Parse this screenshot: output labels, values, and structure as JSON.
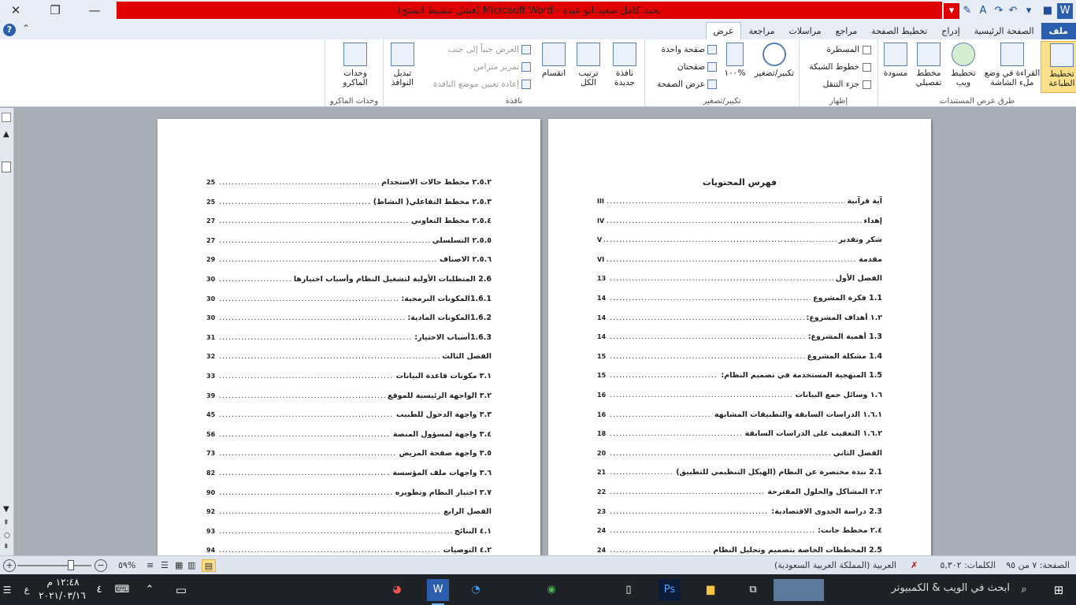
{
  "window": {
    "title": "بحث كامل سعيد ابو عبدة  -  Microsoft Word  (فشل تنشيط المنتج)",
    "minimize": "—",
    "maximize": "❐",
    "close": "✕"
  },
  "tabs": [
    "ملف",
    "الصفحة الرئيسية",
    "إدراج",
    "تخطيط الصفحة",
    "مراجع",
    "مراسلات",
    "مراجعة",
    "عرض"
  ],
  "active_tab": "عرض",
  "ribbon": {
    "groups": {
      "doc_views": {
        "label": "طرق عرض المستندات",
        "print_layout": "تخطيط الطباعة",
        "full_screen": "القراءة في وضع ملء الشاشة",
        "web_layout": "تخطيط ويب",
        "outline": "مخطط تفصيلي",
        "draft": "مسودة"
      },
      "show": {
        "label": "إظهار",
        "ruler": "المسطرة",
        "gridlines": "خطوط الشبكة",
        "nav_pane": "جزء التنقل"
      },
      "zoom": {
        "label": "تكبير/تصغير",
        "zoom": "تكبير/تصغير",
        "hundred": "١٠٠%",
        "one_page": "صفحة واحدة",
        "two_pages": "صفحتان",
        "page_width": "عرض الصفحة"
      },
      "window": {
        "label": "نافذة",
        "new_window": "نافذة جديدة",
        "arrange_all": "ترتيب الكل",
        "split": "انقسام",
        "side_by_side": "العرض جنباً إلى جنب",
        "sync_scroll": "تمرير متزامن",
        "reset_pos": "إعادة تعيين موضع النافذة",
        "switch_windows": "تبديل النوافذ"
      },
      "macros": {
        "label": "وحدات الماكرو",
        "macros": "وحدات الماكرو"
      }
    }
  },
  "page_right": {
    "title": "فهرس المحتويات",
    "rows": [
      {
        "text": "آية قرآنية",
        "page": "III"
      },
      {
        "text": "إهداء",
        "page": "IV"
      },
      {
        "text": "شكر وتقدير",
        "page": "V"
      },
      {
        "text": "مقدمة",
        "page": "VI"
      },
      {
        "text": "الفصل الأول",
        "page": "13"
      },
      {
        "text": "1.1   فكرة المشروع",
        "page": "14"
      },
      {
        "text": "١.٢   أهداف المشروع:",
        "page": "14"
      },
      {
        "text": "1.3   أهمية المشروع:",
        "page": "14"
      },
      {
        "text": "1.4   مشكلة المشروع",
        "page": "15"
      },
      {
        "text": "1.5   المنهجية المستخدمة في تصميم النظام:",
        "page": "15"
      },
      {
        "text": "١.٦   وسائل جمع البيانات",
        "page": "16"
      },
      {
        "text": "١.٦.١  الدراسات السابقة والتطبيقات المشابهة",
        "page": "16"
      },
      {
        "text": "١.٦.٢  التعقيب على الدراسات السابقة",
        "page": "18"
      },
      {
        "text": "الفصل الثاني",
        "page": "20"
      },
      {
        "text": "2.1   نبذة مختصرة عن النظام (الهيكل التنظيمي للتطبيق)",
        "page": "21"
      },
      {
        "text": "٢.٢   المشاكل والحلول المقترحة",
        "page": "22"
      },
      {
        "text": "2.3   دراسة الجدوى الاقتصادية:",
        "page": "23"
      },
      {
        "text": "٢.٤   مخطط جانت:",
        "page": "24"
      },
      {
        "text": "2.5   المخططات الخاصة بتصميم وتحليل النظام",
        "page": "24"
      }
    ]
  },
  "page_left": {
    "rows": [
      {
        "text": "٢.٥.٢ مخطط حالات الاستخدام",
        "page": "25"
      },
      {
        "text": "٢.٥.٣ مخطط التفاعلي( النشاط)",
        "page": "25"
      },
      {
        "text": "٢.٥.٤ مخطط التعاوني",
        "page": "27"
      },
      {
        "text": "٢.٥.٥ التسلسلي",
        "page": "27"
      },
      {
        "text": "٢.٥.٦ الاصناف",
        "page": "29"
      },
      {
        "text": "2.6   المتطلبات الأولية لتشغيل النظام وأسباب اختيارها",
        "page": "30"
      },
      {
        "text": "1.6.1المكونات البرمجية:",
        "page": "30"
      },
      {
        "text": "1.6.2المكونات المادية:",
        "page": "30"
      },
      {
        "text": "1.6.3أسباب الاختيار:",
        "page": "31"
      },
      {
        "text": "الفصل الثالث",
        "page": "32"
      },
      {
        "text": "٣.١   مكونات قاعدة البيانات",
        "page": "33"
      },
      {
        "text": "٣.٢   الواجهة الرئيسية للموقع",
        "page": "39"
      },
      {
        "text": "٣.٣   واجهة الدخول للطبيب",
        "page": "45"
      },
      {
        "text": "٣.٤   واجهة لمسؤول المنصة",
        "page": "56"
      },
      {
        "text": "٣.٥   واجهة صفحة المريض",
        "page": "73"
      },
      {
        "text": "٣.٦   واجهات ملف المؤسسة",
        "page": "82"
      },
      {
        "text": "٣.٧   اختبار النظام وتطويره",
        "page": "90"
      },
      {
        "text": "الفصل الرابع",
        "page": "92"
      },
      {
        "text": "٤.١ النتائج",
        "page": "93"
      },
      {
        "text": "٤.٢ التوصيات",
        "page": "94"
      }
    ]
  },
  "statusbar": {
    "page": "الصفحة: ٧ من ٩٥",
    "words": "الكلمات: ٥,٣٠٢",
    "language": "العربية (المملكة العربية السعودية)",
    "zoom": "٥٩%"
  },
  "taskbar": {
    "search_placeholder": "ابحث في الويب & الكمبيوتر",
    "time": "١٢:٤٨ م",
    "date": "٢٠٢١/٠٣/١٦",
    "notif": "٤",
    "lang_indicator": "ع"
  },
  "colors": {
    "title_red": "#e00000",
    "file_tab": "#2b5fad",
    "selected_btn": "#fde08a"
  }
}
